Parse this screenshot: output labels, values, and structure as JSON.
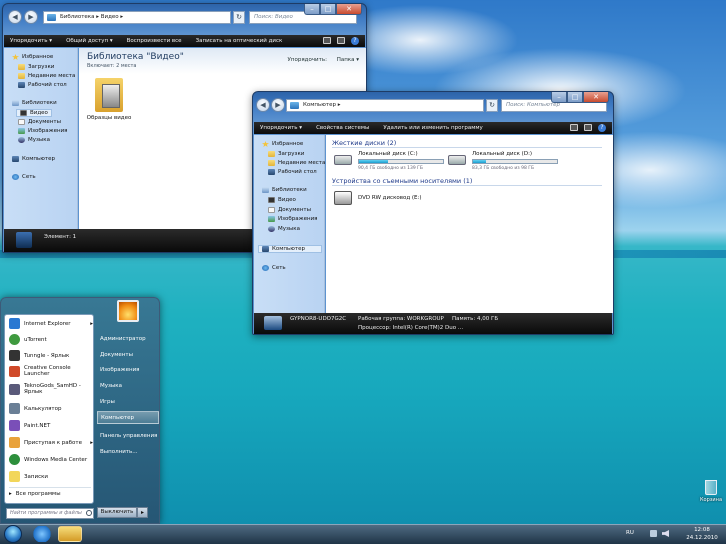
{
  "window1": {
    "address": "Библиотека ▸ Видео ▸",
    "search_placeholder": "Поиск: Видео",
    "toolbar": [
      "Упорядочить ▾",
      "Общий доступ ▾",
      "Воспроизвести все",
      "Записать на оптический диск"
    ],
    "nav": {
      "favorites": "Избранное",
      "downloads": "Загрузки",
      "recent": "Недавние места",
      "desktop": "Рабочий стол",
      "libraries": "Библиотеки",
      "video": "Видео",
      "documents": "Документы",
      "images": "Изображения",
      "music": "Музыка",
      "computer": "Компьютер",
      "network": "Сеть"
    },
    "heading": "Библиотека \"Видео\"",
    "subheading": "Включает: 2 места",
    "arrange_label": "Упорядочить:",
    "arrange_value": "Папка ▾",
    "folder_label": "Образцы видео",
    "status": "Элемент: 1"
  },
  "window2": {
    "address": "Компьютер ▸",
    "search_placeholder": "Поиск: Компьютер",
    "toolbar": [
      "Упорядочить ▾",
      "Свойства системы",
      "Удалить или изменить программу"
    ],
    "nav": {
      "favorites": "Избранное",
      "downloads": "Загрузки",
      "recent": "Недавние места",
      "desktop": "Рабочий стол",
      "libraries": "Библиотеки",
      "video": "Видео",
      "documents": "Документы",
      "images": "Изображения",
      "music": "Музыка",
      "computer": "Компьютер",
      "network": "Сеть"
    },
    "section_hdd": "Жесткие диски (2)",
    "drive_c": {
      "name": "Локальный диск (C:)",
      "free": "90,4 ГБ свободно из 139 ГБ",
      "used_fraction": 0.35
    },
    "drive_d": {
      "name": "Локальный диск (D:)",
      "free": "83,3 ГБ свободно из 98 ГБ",
      "used_fraction": 0.15
    },
    "section_removable": "Устройства со съемными носителями (1)",
    "dvd": "DVD RW дисковод (E:)",
    "status": {
      "computer_name": "GYPNOR8-UDO7G2C",
      "workgroup": "Рабочая группа: WORKGROUP",
      "memory": "Память: 4,00 ГБ",
      "processor": "Процессор: Intel(R) Core(TM)2 Duo ..."
    }
  },
  "start_menu": {
    "programs": [
      {
        "label": "Internet Explorer",
        "arrow": "▸",
        "color": "#2a78d2"
      },
      {
        "label": "uTorrent",
        "arrow": "",
        "color": "#3f9a3f"
      },
      {
        "label": "Tunngle - Ярлык",
        "arrow": "",
        "color": "#333333"
      },
      {
        "label": "Creative Console Launcher",
        "arrow": "",
        "color": "#d04a2a"
      },
      {
        "label": "TeknoGods_SamHD - Ярлык",
        "arrow": "",
        "color": "#5a5a7a"
      },
      {
        "label": "Калькулятор",
        "arrow": "",
        "color": "#6a7f96"
      },
      {
        "label": "Paint.NET",
        "arrow": "",
        "color": "#7a4fb8"
      },
      {
        "label": "Приступая к работе",
        "arrow": "▸",
        "color": "#e9a23b"
      },
      {
        "label": "Windows Media Center",
        "arrow": "",
        "color": "#2d8f3c"
      },
      {
        "label": "Записки",
        "arrow": "",
        "color": "#f2d65a"
      }
    ],
    "all_programs": "Все программы",
    "search_placeholder": "Найти программы и файлы",
    "right": [
      "Администратор",
      "Документы",
      "Изображения",
      "Музыка",
      "Игры",
      "Компьютер",
      "Панель управления",
      "Выполнить..."
    ],
    "shutdown": "Выключить"
  },
  "taskbar": {
    "lang": "RU",
    "time": "12:08",
    "date": "24.12.2010"
  },
  "desktop": {
    "recycle_bin": "Корзина"
  }
}
